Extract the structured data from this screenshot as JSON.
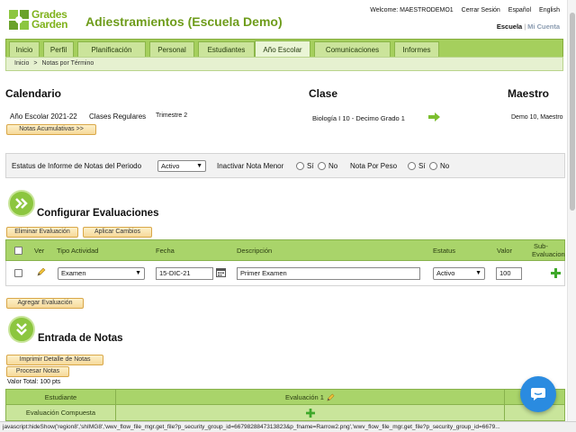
{
  "header": {
    "logo": {
      "line1": "Grades",
      "line2": "Garden"
    },
    "title": "Adiestramientos (Escuela Demo)",
    "welcome": "Welcome: MAESTRODEMO1",
    "logout": "Cerrar Sesión",
    "lang_es": "Español",
    "lang_en": "English",
    "view_school": "Escuela",
    "view_account": "Mi Cuenta"
  },
  "nav": {
    "tabs": [
      {
        "label": "Inicio"
      },
      {
        "label": "Perfil"
      },
      {
        "label": "Planificación"
      },
      {
        "label": "Personal"
      },
      {
        "label": "Estudiantes"
      },
      {
        "label": "Año Escolar"
      },
      {
        "label": "Comunicaciones"
      },
      {
        "label": "Informes"
      }
    ],
    "active_tab": "Año Escolar"
  },
  "breadcrumb": {
    "home": "Inicio",
    "separator": ">",
    "current": "Notas por Término"
  },
  "calendario": {
    "heading": "Calendario",
    "year": "Año Escolar 2021-22",
    "classes": "Clases Regulares",
    "term": "Trimestre 2",
    "accum_button": "Notas Acumulativas >>"
  },
  "clase": {
    "heading": "Clase",
    "value": "Biología I 10 -  Decimo Grado  1"
  },
  "maestro": {
    "heading": "Maestro",
    "value": "Demo 10, Maestro"
  },
  "filters": {
    "status_label": "Estatus de Informe de Notas del Periodo",
    "status_value": "Activo",
    "inactivate_label": "Inactivar Nota Menor",
    "weight_label": "Nota Por Peso",
    "yes": "Sí",
    "no": "No"
  },
  "config": {
    "title": "Configurar Evaluaciones",
    "delete_button": "Eliminar Evaluación",
    "apply_button": "Aplicar Cambios",
    "add_button": "Agregar Evaluación",
    "columns": {
      "view": "Ver",
      "type": "Tipo Actividad",
      "date": "Fecha",
      "description": "Descripción",
      "status": "Estatus",
      "value": "Valor",
      "sub1": "Sub-",
      "sub2": "Evaluacion"
    },
    "rows": [
      {
        "type": "Examen",
        "date": "15-DIC-21",
        "description": "Primer Examen",
        "status": "Activo",
        "value": "100"
      }
    ]
  },
  "grades": {
    "title": "Entrada de Notas",
    "print_button": "Imprimir Detalle de Notas",
    "process_button": "Procesar Notas",
    "total_label": "Valor Total:",
    "total_value": "100 pts",
    "col_student": "Estudiante",
    "col_eval": "Evaluación 1",
    "row_composite": "Evaluación Compuesta"
  },
  "status_bar": "javascript:hideShow('region8','shIMG8','wwv_flow_file_mgr.get_file?p_security_group_id=6679828847313823&p_fname=Rarrow2.png','wwv_flow_file_mgr.get_file?p_security_group_id=6679...",
  "colors": {
    "brand_green": "#8cc63f",
    "nav_green": "#a5cf5d",
    "button_orange": "#f6d99a",
    "chat_blue": "#2a8be0"
  }
}
